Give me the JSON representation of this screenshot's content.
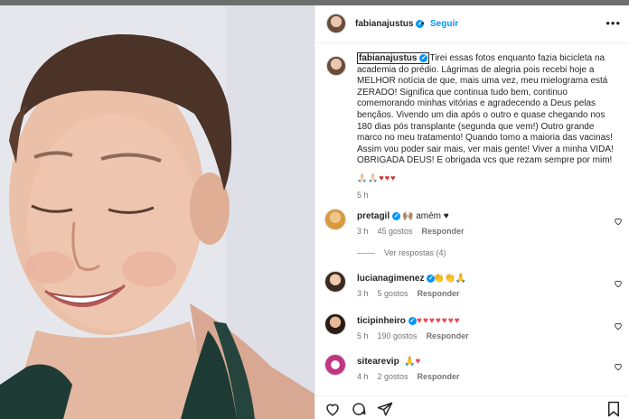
{
  "colors": {
    "link_blue": "#0095f6",
    "heart_red": "#ed4956",
    "muted": "#737373",
    "text": "#262626"
  },
  "header": {
    "username": "fabianajustus",
    "separator": "•",
    "follow_label": "Seguir",
    "more_icon": "more-horizontal-icon"
  },
  "caption": {
    "username": "fabianajustus",
    "text": "Tirei essas fotos enquanto fazia bicicleta na academia do prédio. Lágrimas de alegria pois recebi hoje a MELHOR notícia de que, mais uma vez, meu mielograma está ZERADO! Significa que continua tudo bem, continuo comemorando minhas vitórias e agradecendo a Deus pelas bençãos. Vivendo um dia após o outro e quase chegando nos 180 dias pós transplante (segunda que vem!) Outro grande marco no meu tratamento! Quando tomo a maioria das vacinas! Assim vou poder sair mais, ver mais gente! Viver a minha VIDA! OBRIGADA DEUS! E obrigada vcs que rezam sempre por mim!",
    "emojis": "🙏🏻🙏🏻♥♥♥",
    "time": "5 h"
  },
  "comments": [
    {
      "username": "pretagil",
      "text": "🙌🏽 amém ♥",
      "time": "3 h",
      "likes": "45 gostos",
      "reply": "Responder",
      "view_replies": "Ver respostas (4)"
    },
    {
      "username": "lucianagimenez",
      "text": "👏👏🙏",
      "time": "3 h",
      "likes": "5 gostos",
      "reply": "Responder"
    },
    {
      "username": "ticipinheiro",
      "text": "♥♥♥♥♥♥♥",
      "time": "5 h",
      "likes": "190 gostos",
      "reply": "Responder"
    },
    {
      "username": "sitearevip",
      "text": "🙏♥",
      "time": "4 h",
      "likes": "2 gostos",
      "reply": "Responder"
    }
  ],
  "actions": [
    "heart-icon",
    "comment-icon",
    "share-icon",
    "bookmark-icon"
  ]
}
